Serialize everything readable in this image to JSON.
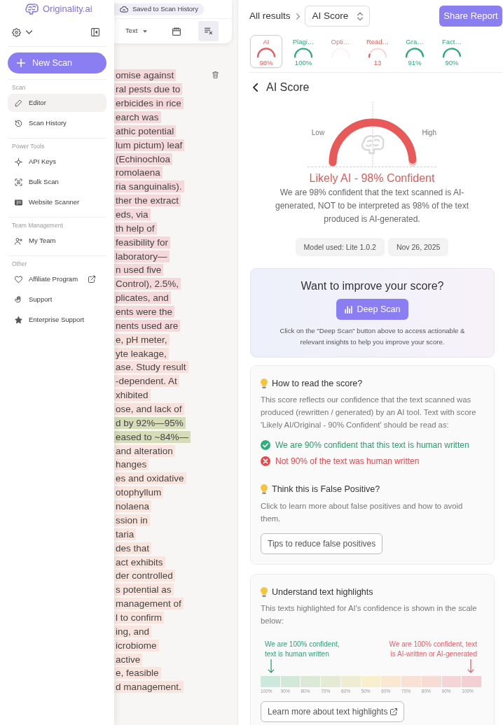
{
  "sidebar": {
    "logo": "Originality.ai",
    "new_scan": "New Scan",
    "sections": [
      {
        "title": "Scan",
        "items": [
          {
            "label": "Editor",
            "selected": true,
            "external": false
          },
          {
            "label": "Scan History",
            "selected": false,
            "external": false
          }
        ]
      },
      {
        "title": "Power Tools",
        "items": [
          {
            "label": "API Keys",
            "selected": false,
            "external": false
          },
          {
            "label": "Bulk Scan",
            "selected": false,
            "external": false
          },
          {
            "label": "Website Scanner",
            "selected": false,
            "external": false
          }
        ]
      },
      {
        "title": "Team Management",
        "items": [
          {
            "label": "My Team",
            "selected": false,
            "external": false
          }
        ]
      },
      {
        "title": "Other",
        "items": [
          {
            "label": "Affiliate Program",
            "selected": false,
            "external": true
          },
          {
            "label": "Support",
            "selected": false,
            "external": false
          },
          {
            "label": "Enterprise Support",
            "selected": false,
            "external": false
          }
        ]
      }
    ]
  },
  "editor": {
    "save_status": "Saved to Scan History",
    "format": "Text",
    "lines": [
      {
        "text": "omise against",
        "color": "#f5d8da"
      },
      {
        "text": "ral pests due to",
        "color": "#f5d8da"
      },
      {
        "text": "erbicides in rice",
        "color": "#f5d8da"
      },
      {
        "text": "earch was",
        "color": "#f5d8da"
      },
      {
        "text": "athic potential",
        "color": "#f5d8da"
      },
      {
        "text": "lum pictum) leaf",
        "color": "#f5d8da"
      },
      {
        "text": "(Echinochloa",
        "color": "#f5d8da"
      },
      {
        "text": "romolaena",
        "color": "#f5d8da"
      },
      {
        "text": "ria sanguinalis).",
        "color": "#f5d8da"
      },
      {
        "text": "ther the extract",
        "color": "#f5d8da"
      },
      {
        "text": "eds, via",
        "color": "#f5d8da"
      },
      {
        "text": "th help of",
        "color": "#f5d8da"
      },
      {
        "text": "feasibility for",
        "color": "#f5d8da"
      },
      {
        "text": "laboratory—",
        "color": "#f5d8da"
      },
      {
        "text": "n used five",
        "color": "#f5d8da"
      },
      {
        "text": "Control), 2.5%,",
        "color": "#f5d8da"
      },
      {
        "text": "plicates, and",
        "color": "#f5d8da"
      },
      {
        "text": "ents were the",
        "color": "#f5d8da"
      },
      {
        "text": "nents used are",
        "color": "#f5d8da"
      },
      {
        "text": "e, pH meter,",
        "color": "#f8e0dc"
      },
      {
        "text": "yte leakage,",
        "color": "#f8e0dc"
      },
      {
        "text": "ase. Study result",
        "color": "#f8e0dc"
      },
      {
        "text": "-dependent. At",
        "color": "#f8e0dc"
      },
      {
        "text": "xhibited",
        "color": "#f8e0dc"
      },
      {
        "text": "ose, and lack of",
        "color": "#f8e0dc"
      },
      {
        "text": "d by 92%—95%",
        "color": "#d6dbb8"
      },
      {
        "text": "eased to ~84%—",
        "color": "#d6dbb8"
      },
      {
        "text": "and alteration",
        "color": "#fae5de"
      },
      {
        "text": "hanges",
        "color": "#fae5de"
      },
      {
        "text": "es and oxidative",
        "color": "#fae5de"
      },
      {
        "text": "otophyllum",
        "color": "#fae5de"
      },
      {
        "text": "nolaena",
        "color": "#fae5de"
      },
      {
        "text": "ssion in",
        "color": "#fae5de"
      },
      {
        "text": "taria",
        "color": "#fae5de"
      },
      {
        "text": "des that",
        "color": "#fae5de"
      },
      {
        "text": "act exhibits",
        "color": "#fae5de"
      },
      {
        "text": "der controlled",
        "color": "#fae5de"
      },
      {
        "text": "s potential as",
        "color": "#fae5de"
      },
      {
        "text": "management of",
        "color": "#fae5de"
      },
      {
        "text": "l to confirm",
        "color": "#fae5de"
      },
      {
        "text": "ing, and",
        "color": "#fae5de"
      },
      {
        "text": "icrobiome",
        "color": "#fae5de"
      },
      {
        "text": "active",
        "color": "#fae5de"
      },
      {
        "text": "e, feasible",
        "color": "#fae5de"
      },
      {
        "text": "d management.",
        "color": "#fae5de"
      }
    ]
  },
  "results": {
    "breadcrumb": "All results",
    "view_select": "AI Score",
    "share_button": "Share Report",
    "score_tabs": [
      {
        "label": "AI",
        "value": "98%",
        "level": 0.98,
        "color": "#e35d5d",
        "selected": true,
        "disabled": false
      },
      {
        "label": "Plagi…",
        "value": "100%",
        "level": 1,
        "color": "#2ea77c",
        "selected": false,
        "disabled": false
      },
      {
        "label": "Opti…",
        "selected": false,
        "disabled": true
      },
      {
        "label": "Read…",
        "value": "13",
        "level": 0.1,
        "color": "#e35d5d",
        "selected": false,
        "disabled": false
      },
      {
        "label": "Gra…",
        "value": "91%",
        "level": 0.97,
        "color": "#2ea77c",
        "selected": false,
        "disabled": false
      },
      {
        "label": "Fact…",
        "value": "90%",
        "level": 0.96,
        "color": "#2ea77c",
        "selected": false,
        "disabled": false
      }
    ],
    "section_title": "AI Score",
    "gauge": {
      "low": "Low",
      "high": "High",
      "level": 0.98
    },
    "verdict": "Likely AI - 98% Confident",
    "description": "We are 98% confident that the text scanned is AI-generated, NOT to be interpreted as 98% of the text produced is AI-generated.",
    "info": [
      "Model used: Lite 1.0.2",
      "Nov 26, 2025"
    ]
  },
  "improve_card": {
    "title": "Want to improve your score?",
    "button": "Deep Scan",
    "note": "Click on the \"Deep Scan\" button above to access actionable & relevant insights to help you improve your score."
  },
  "read_card": {
    "heading": "How to read the score?",
    "text": "This score reflects our confidence that the text scanned was produced (rewritten / generated) by an AI tool. Text with score 'Likely AI/Original - 90% Confident' should be read as:",
    "points": [
      {
        "kind": "correct",
        "text": "We are 90% confident that this text is human written"
      },
      {
        "kind": "incorrect",
        "text": "Not 90% of the text was human written"
      }
    ],
    "heading_2": "Think this is False Positive?",
    "text_2": "Click to learn more about false positives and how to avoid them.",
    "button": "Tips to reduce false positives"
  },
  "highlights_card": {
    "heading": "Understand text highlights",
    "text": "This texts highlighted for AI's confidence is shown in the scale below:",
    "human_caption": "We are 100% confident, text is human written",
    "ai_caption": "We are 100% confident, text is AI-written or AI-generated",
    "scale": [
      {
        "label": "100%",
        "color": "#cde8dc"
      },
      {
        "label": "90%",
        "color": "#d4e8d9"
      },
      {
        "label": "80%",
        "color": "#dce9d6"
      },
      {
        "label": "70%",
        "color": "#e4ead3"
      },
      {
        "label": "60%",
        "color": "#eeecd2"
      },
      {
        "label": "50%",
        "color": "#f8efd0"
      },
      {
        "label": "60%",
        "color": "#fbe8d3"
      },
      {
        "label": "70%",
        "color": "#f9e2d5"
      },
      {
        "label": "80%",
        "color": "#f7dcd6"
      },
      {
        "label": "90%",
        "color": "#f4d4d6"
      },
      {
        "label": "100%",
        "color": "#f3cfd3"
      }
    ],
    "button": "Learn more about text highlights"
  }
}
